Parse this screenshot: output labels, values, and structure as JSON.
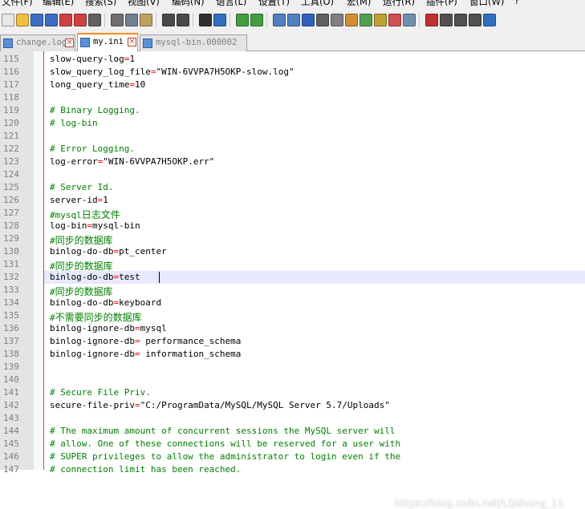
{
  "menu": [
    "文件(F)",
    "编辑(E)",
    "搜索(S)",
    "视图(V)",
    "编码(N)",
    "语言(L)",
    "设置(T)",
    "工具(O)",
    "宏(M)",
    "运行(R)",
    "插件(P)",
    "窗口(W)",
    "?"
  ],
  "toolbar_icons": [
    "new-file-icon",
    "open-file-icon",
    "save-icon",
    "save-all-icon",
    "close-icon",
    "close-all-icon",
    "print-icon",
    "cut-icon",
    "copy-icon",
    "paste-icon",
    "undo-icon",
    "redo-icon",
    "find-icon",
    "replace-icon",
    "zoom-in-icon",
    "zoom-out-icon",
    "sync-vertical-icon",
    "sync-horizontal-icon",
    "word-wrap-icon",
    "show-all-chars-icon",
    "indent-guide-icon",
    "language-icon",
    "doc-map-icon",
    "function-list-icon",
    "folder-as-workspace-icon",
    "monitor-icon",
    "record-macro-icon",
    "stop-record-icon",
    "play-macro-icon",
    "run-macro-multiple-icon",
    "save-macro-icon"
  ],
  "tabs": [
    {
      "label": "change.log",
      "active": false
    },
    {
      "label": "my.ini",
      "active": true
    },
    {
      "label": "mysql-bin.000002",
      "active": false
    }
  ],
  "lines": [
    {
      "num": "115",
      "text": "slow-query-log=1"
    },
    {
      "num": "116",
      "text": "slow_query_log_file=\"WIN-6VVPA7H5OKP-slow.log\""
    },
    {
      "num": "117",
      "text": "long_query_time=10"
    },
    {
      "num": "118",
      "text": ""
    },
    {
      "num": "119",
      "text": "# Binary Logging."
    },
    {
      "num": "120",
      "text": "# log-bin"
    },
    {
      "num": "121",
      "text": ""
    },
    {
      "num": "122",
      "text": "# Error Logging."
    },
    {
      "num": "123",
      "text": "log-error=\"WIN-6VVPA7H5OKP.err\""
    },
    {
      "num": "124",
      "text": ""
    },
    {
      "num": "125",
      "text": "# Server Id."
    },
    {
      "num": "126",
      "text": "server-id=1"
    },
    {
      "num": "127",
      "text": "#mysql日志文件"
    },
    {
      "num": "128",
      "text": "log-bin=mysql-bin"
    },
    {
      "num": "129",
      "text": "#同步的数据库"
    },
    {
      "num": "130",
      "text": "binlog-do-db=pt_center"
    },
    {
      "num": "131",
      "text": "#同步的数据库"
    },
    {
      "num": "132",
      "text": "binlog-do-db=test"
    },
    {
      "num": "133",
      "text": "#同步的数据库"
    },
    {
      "num": "134",
      "text": "binlog-do-db=keyboard"
    },
    {
      "num": "135",
      "text": "#不需要同步的数据库"
    },
    {
      "num": "136",
      "text": "binlog-ignore-db=mysql"
    },
    {
      "num": "137",
      "text": "binlog-ignore-db= performance_schema"
    },
    {
      "num": "138",
      "text": "binlog-ignore-db= information_schema"
    },
    {
      "num": "139",
      "text": ""
    },
    {
      "num": "140",
      "text": ""
    },
    {
      "num": "141",
      "text": "# Secure File Priv."
    },
    {
      "num": "142",
      "text": "secure-file-priv=\"C:/ProgramData/MySQL/MySQL Server 5.7/Uploads\""
    },
    {
      "num": "143",
      "text": ""
    },
    {
      "num": "144",
      "text": "# The maximum amount of concurrent sessions the MySQL server will"
    },
    {
      "num": "145",
      "text": "# allow. One of these connections will be reserved for a user with"
    },
    {
      "num": "146",
      "text": "# SUPER privileges to allow the administrator to login even if the"
    },
    {
      "num": "147",
      "text": "# connection limit has been reached."
    }
  ],
  "watermark": "https://blog.csdn.net/LQzhang_11",
  "colors": {
    "comment": "#008000",
    "operator": "#ff0000",
    "edge_line": "#d94040",
    "current_line": "#e8e8ff",
    "active_tab_accent": "#fa8c1e"
  }
}
